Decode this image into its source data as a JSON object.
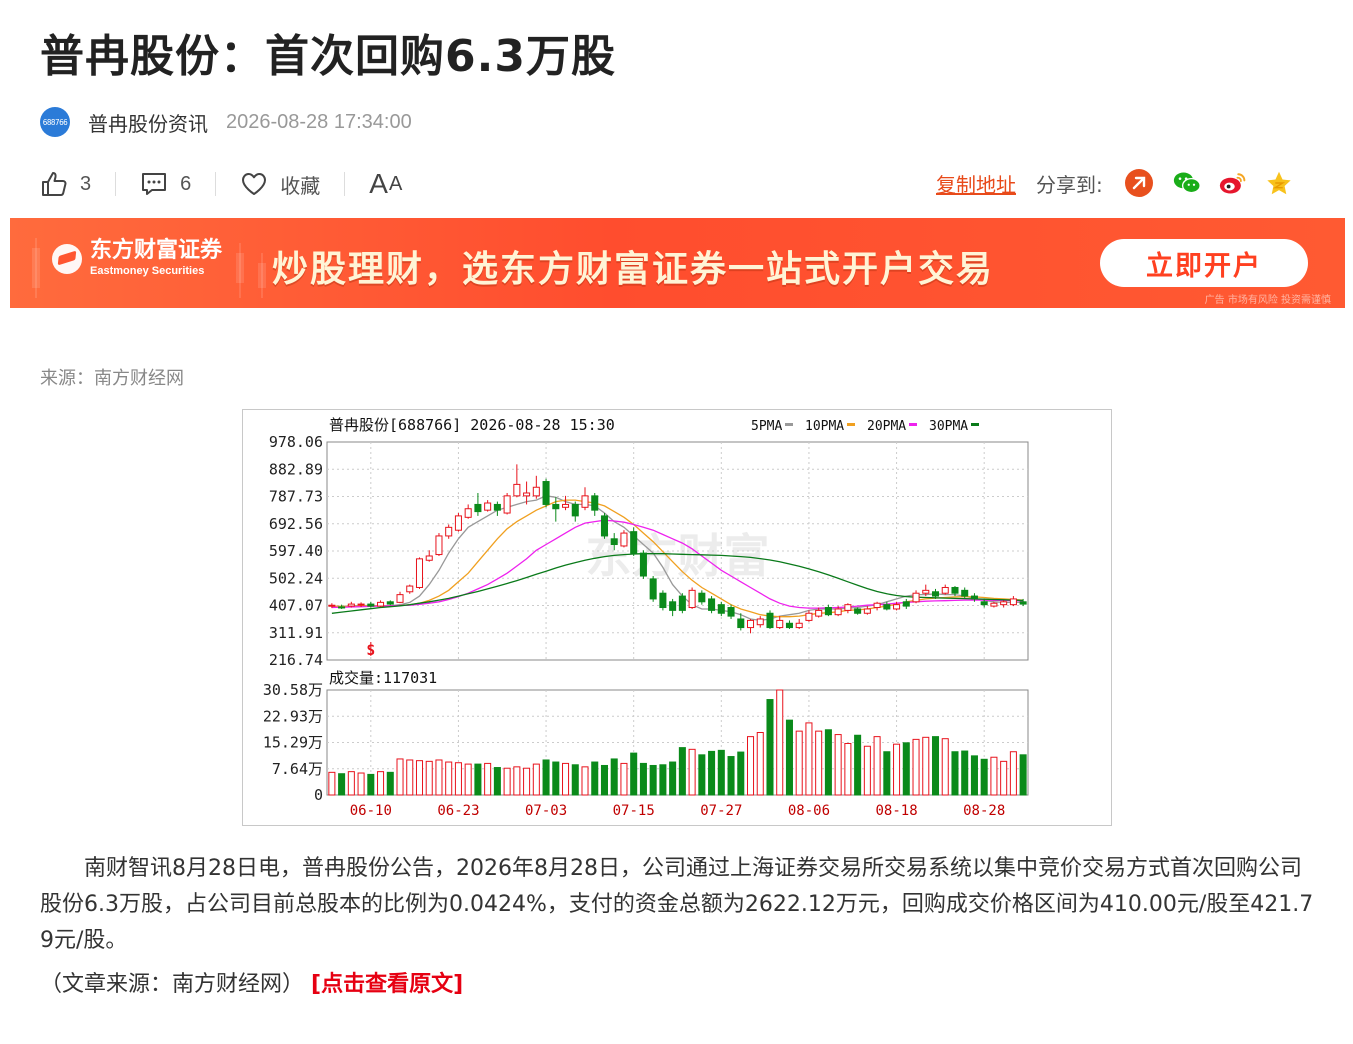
{
  "article": {
    "title": "普冉股份：首次回购6.3万股",
    "author": "普冉股份资讯",
    "avatar_text": "688766",
    "time": "2026-08-28 17:34:00"
  },
  "actions": {
    "like_count": "3",
    "comment_count": "6",
    "favorite_label": "收藏",
    "font_big": "A",
    "font_small": "A",
    "copy_link": "复制地址",
    "share_label": "分享到:"
  },
  "banner": {
    "brand_cn": "东方财富证券",
    "brand_en": "Eastmoney Securities",
    "slogan": "炒股理财，选东方财富证券一站式开户交易",
    "cta": "立即开户",
    "disclaimer": "广告 市场有风险 投资需谨慎"
  },
  "source": "来源：南方财经网",
  "chart_data": {
    "type": "candlestick",
    "title": "普冉股份[688766] 2026-08-28 15:30",
    "ma_legend": [
      {
        "name": "5PMA",
        "color": "#999999"
      },
      {
        "name": "10PMA",
        "color": "#f0a020"
      },
      {
        "name": "20PMA",
        "color": "#ee22ee"
      },
      {
        "name": "30PMA",
        "color": "#0a7a1a"
      }
    ],
    "watermark": "东方财富",
    "signal_marker": "S",
    "price_ticks": [
      "978.06",
      "882.89",
      "787.73",
      "692.56",
      "597.40",
      "502.24",
      "407.07",
      "311.91",
      "216.74"
    ],
    "price_range": [
      216.74,
      978.06
    ],
    "volume_label": "成交量:117031",
    "volume_ticks": [
      "30.58万",
      "22.93万",
      "15.29万",
      "7.64万",
      "0"
    ],
    "volume_range": [
      0,
      305800
    ],
    "date_labels": [
      "06-10",
      "06-23",
      "07-03",
      "07-15",
      "07-27",
      "08-06",
      "08-18",
      "08-28"
    ],
    "candles": [
      {
        "o": 405,
        "c": 408,
        "h": 415,
        "l": 398,
        "v": 66000
      },
      {
        "o": 402,
        "c": 400,
        "h": 410,
        "l": 395,
        "v": 62000
      },
      {
        "o": 405,
        "c": 412,
        "h": 420,
        "l": 400,
        "v": 68000
      },
      {
        "o": 410,
        "c": 412,
        "h": 418,
        "l": 402,
        "v": 64000
      },
      {
        "o": 412,
        "c": 405,
        "h": 420,
        "l": 400,
        "v": 60000
      },
      {
        "o": 405,
        "c": 418,
        "h": 425,
        "l": 402,
        "v": 68000
      },
      {
        "o": 420,
        "c": 412,
        "h": 425,
        "l": 408,
        "v": 66000
      },
      {
        "o": 418,
        "c": 445,
        "h": 455,
        "l": 415,
        "v": 105000
      },
      {
        "o": 455,
        "c": 475,
        "h": 480,
        "l": 448,
        "v": 102000
      },
      {
        "o": 470,
        "c": 570,
        "h": 575,
        "l": 465,
        "v": 100000
      },
      {
        "o": 565,
        "c": 580,
        "h": 600,
        "l": 560,
        "v": 98000
      },
      {
        "o": 585,
        "c": 650,
        "h": 660,
        "l": 580,
        "v": 102000
      },
      {
        "o": 650,
        "c": 680,
        "h": 690,
        "l": 640,
        "v": 96000
      },
      {
        "o": 670,
        "c": 720,
        "h": 730,
        "l": 665,
        "v": 94000
      },
      {
        "o": 715,
        "c": 745,
        "h": 760,
        "l": 710,
        "v": 90000
      },
      {
        "o": 760,
        "c": 735,
        "h": 800,
        "l": 720,
        "v": 90000
      },
      {
        "o": 740,
        "c": 765,
        "h": 775,
        "l": 735,
        "v": 92000
      },
      {
        "o": 760,
        "c": 740,
        "h": 770,
        "l": 720,
        "v": 80000
      },
      {
        "o": 730,
        "c": 790,
        "h": 800,
        "l": 725,
        "v": 78000
      },
      {
        "o": 790,
        "c": 830,
        "h": 900,
        "l": 785,
        "v": 82000
      },
      {
        "o": 790,
        "c": 800,
        "h": 840,
        "l": 760,
        "v": 78000
      },
      {
        "o": 790,
        "c": 820,
        "h": 860,
        "l": 780,
        "v": 90000
      },
      {
        "o": 840,
        "c": 760,
        "h": 850,
        "l": 750,
        "v": 102000
      },
      {
        "o": 760,
        "c": 745,
        "h": 785,
        "l": 700,
        "v": 96000
      },
      {
        "o": 750,
        "c": 760,
        "h": 790,
        "l": 740,
        "v": 92000
      },
      {
        "o": 760,
        "c": 720,
        "h": 770,
        "l": 700,
        "v": 88000
      },
      {
        "o": 750,
        "c": 790,
        "h": 820,
        "l": 740,
        "v": 82000
      },
      {
        "o": 790,
        "c": 740,
        "h": 800,
        "l": 720,
        "v": 96000
      },
      {
        "o": 720,
        "c": 650,
        "h": 730,
        "l": 640,
        "v": 86000
      },
      {
        "o": 640,
        "c": 620,
        "h": 660,
        "l": 600,
        "v": 105000
      },
      {
        "o": 615,
        "c": 660,
        "h": 670,
        "l": 610,
        "v": 92000
      },
      {
        "o": 665,
        "c": 590,
        "h": 680,
        "l": 580,
        "v": 122000
      },
      {
        "o": 590,
        "c": 510,
        "h": 600,
        "l": 500,
        "v": 92000
      },
      {
        "o": 500,
        "c": 430,
        "h": 510,
        "l": 420,
        "v": 86000
      },
      {
        "o": 450,
        "c": 400,
        "h": 460,
        "l": 390,
        "v": 88000
      },
      {
        "o": 420,
        "c": 390,
        "h": 430,
        "l": 370,
        "v": 96000
      },
      {
        "o": 440,
        "c": 390,
        "h": 450,
        "l": 380,
        "v": 138000
      },
      {
        "o": 400,
        "c": 460,
        "h": 470,
        "l": 395,
        "v": 133000
      },
      {
        "o": 450,
        "c": 420,
        "h": 460,
        "l": 410,
        "v": 117000
      },
      {
        "o": 430,
        "c": 390,
        "h": 440,
        "l": 380,
        "v": 127000
      },
      {
        "o": 410,
        "c": 380,
        "h": 420,
        "l": 370,
        "v": 130000
      },
      {
        "o": 400,
        "c": 370,
        "h": 410,
        "l": 360,
        "v": 112000
      },
      {
        "o": 360,
        "c": 330,
        "h": 380,
        "l": 320,
        "v": 125000
      },
      {
        "o": 330,
        "c": 355,
        "h": 360,
        "l": 310,
        "v": 170000
      },
      {
        "o": 340,
        "c": 360,
        "h": 370,
        "l": 330,
        "v": 182000
      },
      {
        "o": 380,
        "c": 330,
        "h": 390,
        "l": 325,
        "v": 278000
      },
      {
        "o": 330,
        "c": 355,
        "h": 370,
        "l": 325,
        "v": 305800
      },
      {
        "o": 345,
        "c": 330,
        "h": 355,
        "l": 325,
        "v": 218000
      },
      {
        "o": 330,
        "c": 345,
        "h": 360,
        "l": 325,
        "v": 186000
      },
      {
        "o": 355,
        "c": 380,
        "h": 390,
        "l": 350,
        "v": 210000
      },
      {
        "o": 370,
        "c": 390,
        "h": 400,
        "l": 365,
        "v": 186000
      },
      {
        "o": 400,
        "c": 375,
        "h": 410,
        "l": 370,
        "v": 190000
      },
      {
        "o": 375,
        "c": 395,
        "h": 405,
        "l": 370,
        "v": 176000
      },
      {
        "o": 390,
        "c": 410,
        "h": 415,
        "l": 380,
        "v": 150000
      },
      {
        "o": 395,
        "c": 380,
        "h": 400,
        "l": 375,
        "v": 174000
      },
      {
        "o": 380,
        "c": 395,
        "h": 405,
        "l": 375,
        "v": 142000
      },
      {
        "o": 400,
        "c": 415,
        "h": 420,
        "l": 390,
        "v": 170000
      },
      {
        "o": 410,
        "c": 395,
        "h": 420,
        "l": 390,
        "v": 126000
      },
      {
        "o": 395,
        "c": 410,
        "h": 420,
        "l": 390,
        "v": 148000
      },
      {
        "o": 420,
        "c": 405,
        "h": 430,
        "l": 395,
        "v": 152000
      },
      {
        "o": 420,
        "c": 450,
        "h": 460,
        "l": 415,
        "v": 162000
      },
      {
        "o": 450,
        "c": 460,
        "h": 480,
        "l": 440,
        "v": 168000
      },
      {
        "o": 455,
        "c": 440,
        "h": 465,
        "l": 430,
        "v": 170000
      },
      {
        "o": 450,
        "c": 470,
        "h": 480,
        "l": 445,
        "v": 164000
      },
      {
        "o": 470,
        "c": 450,
        "h": 475,
        "l": 440,
        "v": 126000
      },
      {
        "o": 460,
        "c": 440,
        "h": 470,
        "l": 430,
        "v": 128000
      },
      {
        "o": 440,
        "c": 430,
        "h": 450,
        "l": 420,
        "v": 114000
      },
      {
        "o": 420,
        "c": 410,
        "h": 430,
        "l": 400,
        "v": 104000
      },
      {
        "o": 405,
        "c": 415,
        "h": 420,
        "l": 400,
        "v": 110000
      },
      {
        "o": 410,
        "c": 420,
        "h": 425,
        "l": 400,
        "v": 98000
      },
      {
        "o": 410,
        "c": 430,
        "h": 440,
        "l": 405,
        "v": 126000
      },
      {
        "o": 420,
        "c": 412,
        "h": 430,
        "l": 405,
        "v": 117031
      }
    ],
    "ma_lines": {
      "ma5": [
        405,
        404,
        406,
        407,
        407,
        406,
        406,
        410,
        418,
        440,
        480,
        530,
        590,
        640,
        680,
        700,
        720,
        740,
        750,
        760,
        770,
        775,
        790,
        785,
        770,
        760,
        760,
        755,
        730,
        700,
        680,
        650,
        620,
        590,
        540,
        480,
        440,
        410,
        395,
        395,
        390,
        385,
        375,
        360,
        355,
        360,
        370,
        375,
        380,
        390,
        395,
        395,
        395,
        398,
        400,
        405,
        410,
        420,
        430,
        440,
        445,
        445,
        448,
        445,
        445,
        440,
        432,
        425,
        420,
        418,
        418,
        418
      ],
      "ma10": [
        405,
        404,
        404,
        405,
        406,
        406,
        406,
        407,
        409,
        415,
        425,
        440,
        460,
        490,
        520,
        560,
        600,
        640,
        675,
        700,
        720,
        740,
        755,
        770,
        775,
        775,
        770,
        765,
        755,
        735,
        715,
        690,
        660,
        630,
        595,
        560,
        525,
        495,
        470,
        450,
        430,
        410,
        395,
        385,
        375,
        370,
        368,
        368,
        370,
        375,
        380,
        382,
        385,
        390,
        392,
        395,
        400,
        405,
        412,
        420,
        425,
        430,
        433,
        435,
        437,
        438,
        437,
        435,
        432,
        430,
        428,
        426
      ],
      "ma20": [
        400,
        401,
        402,
        403,
        404,
        405,
        406,
        407,
        408,
        411,
        415,
        420,
        428,
        438,
        450,
        465,
        480,
        500,
        520,
        545,
        570,
        600,
        620,
        640,
        660,
        680,
        695,
        700,
        705,
        702,
        698,
        690,
        680,
        670,
        655,
        640,
        625,
        605,
        580,
        555,
        530,
        510,
        490,
        470,
        450,
        430,
        415,
        405,
        400,
        398,
        398,
        399,
        400,
        402,
        405,
        408,
        410,
        412,
        415,
        418,
        420,
        422,
        423,
        424,
        425,
        426,
        426,
        426,
        425,
        425,
        424,
        423
      ],
      "ma30": [
        380,
        384,
        388,
        392,
        396,
        400,
        403,
        406,
        410,
        415,
        420,
        426,
        432,
        440,
        448,
        456,
        465,
        474,
        484,
        494,
        505,
        516,
        527,
        538,
        548,
        557,
        565,
        572,
        578,
        582,
        585,
        587,
        588,
        588,
        588,
        587,
        586,
        585,
        584,
        583,
        582,
        580,
        578,
        575,
        571,
        566,
        560,
        552,
        544,
        535,
        525,
        514,
        502,
        490,
        478,
        466,
        456,
        448,
        442,
        438,
        436,
        435,
        434,
        433,
        432,
        431,
        430,
        429,
        428,
        427,
        426,
        425
      ]
    }
  },
  "body": {
    "paragraph": "南财智讯8月28日电，普冉股份公告，2026年8月28日，公司通过上海证券交易所交易系统以集中竞价交易方式首次回购公司股份6.3万股，占公司目前总股本的比例为0.0424%，支付的资金总额为2622.12万元，回购成交价格区间为410.00元/股至421.79元/股。",
    "source_note": "（文章来源：南方财经网）",
    "link_text": "[点击查看原文]"
  },
  "colors": {
    "up": "#e8131c",
    "down": "#0a8a1a",
    "accent": "#e84a1a",
    "banner": "#ff5530"
  }
}
